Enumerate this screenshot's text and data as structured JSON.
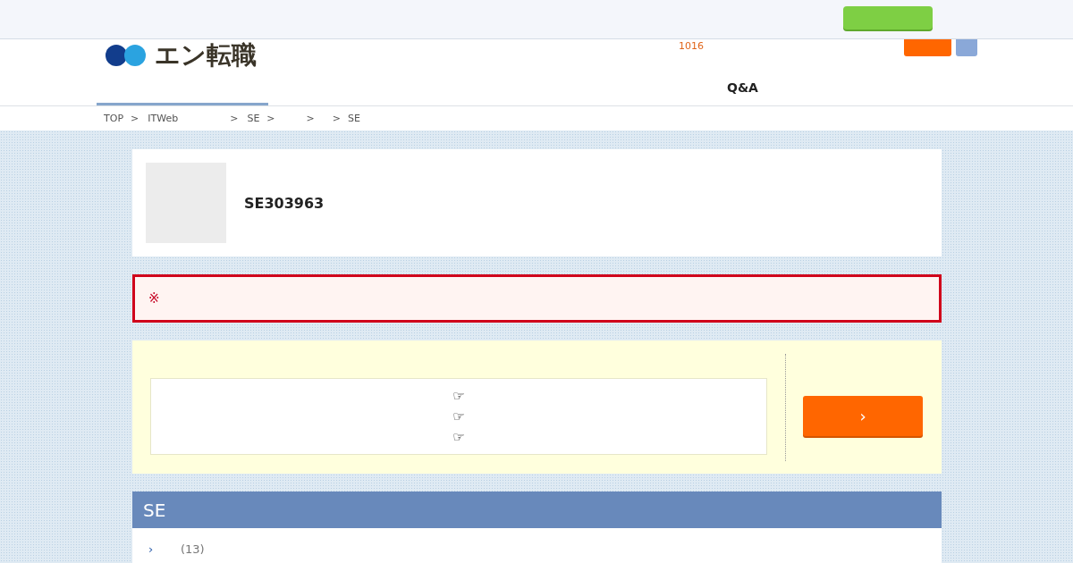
{
  "top_bar": {
    "button": {
      "kind": "green"
    }
  },
  "header": {
    "logo_text": "エン転職",
    "count": "1016"
  },
  "nav": {
    "tabs": [
      {
        "selected": true
      }
    ],
    "qa": "Q&A"
  },
  "breadcrumb": [
    "TOP",
    ">",
    "ITWeb",
    ">",
    "SE",
    ">",
    ">",
    ">",
    "SE"
  ],
  "job": {
    "title": "SE303963"
  },
  "alert": {
    "mark": "※"
  },
  "apply_box": {
    "points": [
      "☞",
      "☞",
      "☞"
    ],
    "button": "›"
  },
  "section": {
    "title": "SE",
    "rows": [
      {
        "arrow": "›",
        "count": "(13)"
      }
    ]
  }
}
